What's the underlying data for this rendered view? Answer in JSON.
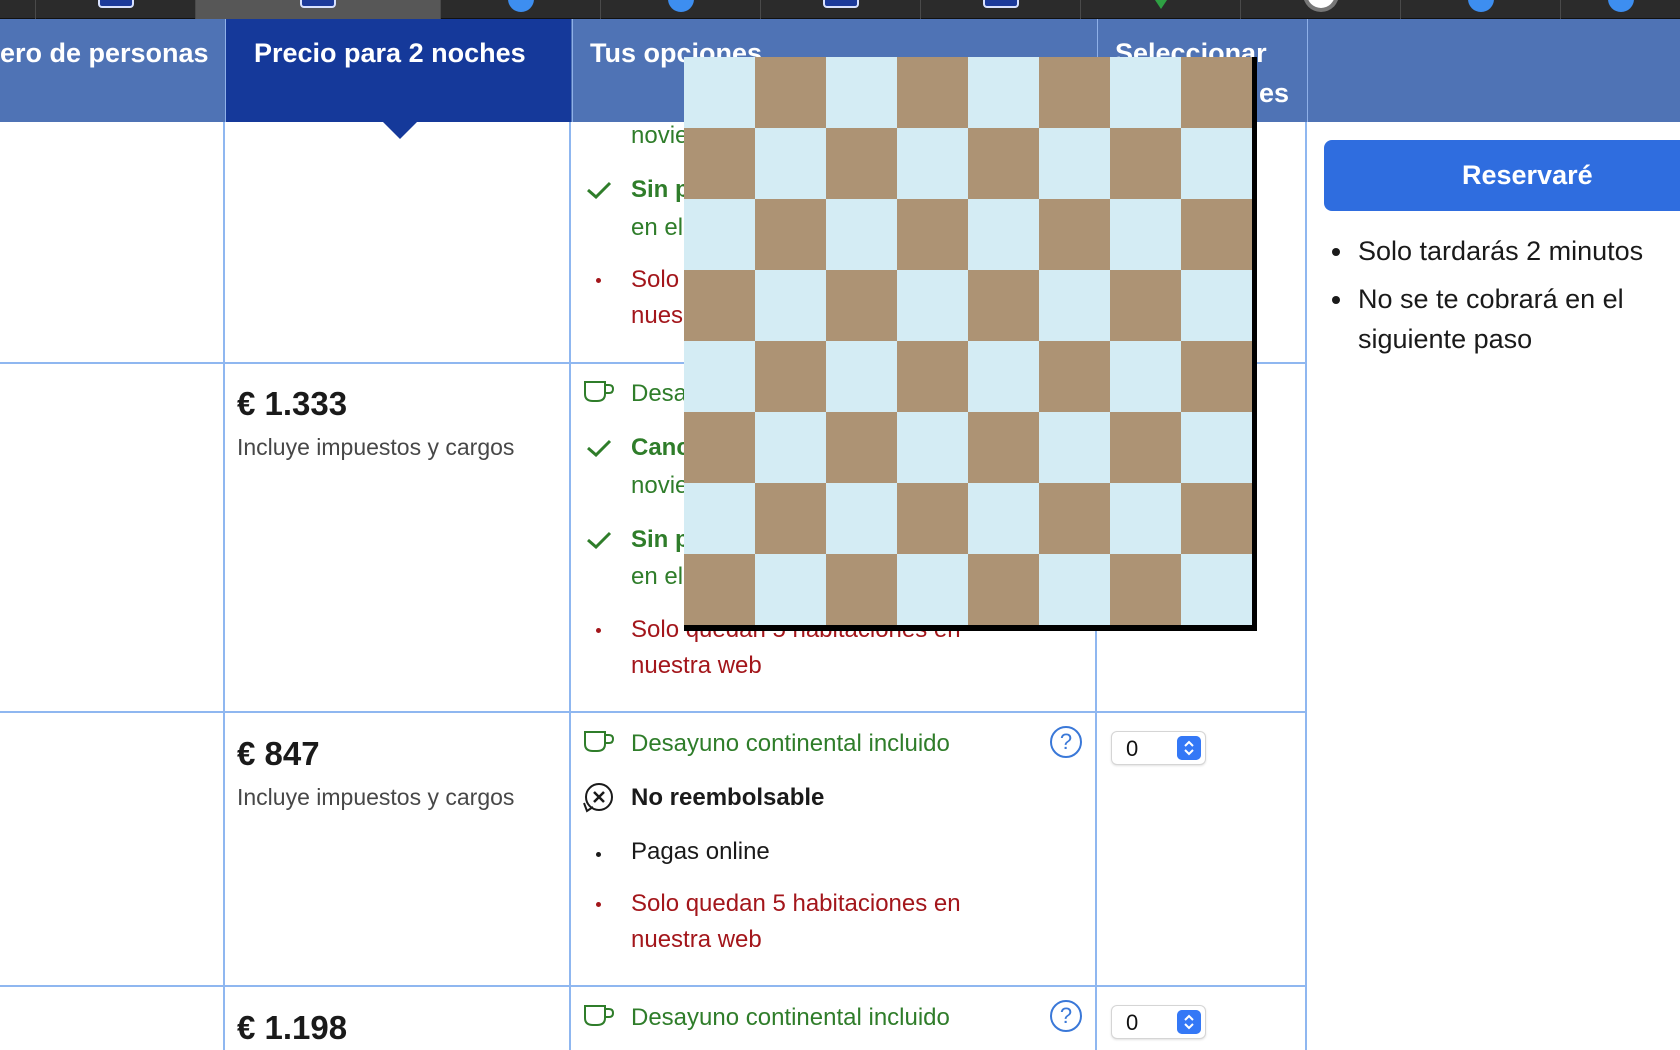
{
  "tabs": [
    {
      "icon": "square-favicon"
    },
    {
      "icon": "square-favicon",
      "active": true
    },
    {
      "icon": "circle-favicon"
    },
    {
      "icon": "circle-favicon"
    },
    {
      "icon": "square-favicon"
    },
    {
      "icon": "square-favicon"
    },
    {
      "icon": "triangle-favicon"
    },
    {
      "icon": "ring-favicon"
    },
    {
      "icon": "circle-favicon"
    },
    {
      "icon": "circle-favicon"
    }
  ],
  "header": {
    "col_persons": "ero de personas",
    "col_price": "Precio para 2 noches",
    "col_options": "Tus opciones",
    "col_select_line1": "Seleccionar",
    "col_select_line2": "es"
  },
  "rows": [
    {
      "options": {
        "line_top": "novie",
        "item1_bold": "Sin p",
        "item1_sub": "en el",
        "item2_line1": "Solo",
        "item2_line2": "nues"
      }
    },
    {
      "price": "€ 1.333",
      "price_note": "Incluye impuestos y cargos",
      "options": {
        "breakfast": "Desa",
        "cancel_bold": "Canc",
        "cancel_sub": "novie",
        "prepay_bold": "Sin p",
        "prepay_sub": "en el",
        "avail_line1": "Solo quedan 5 habitaciones en",
        "avail_line2": "nuestra web"
      }
    },
    {
      "price": "€ 847",
      "price_note": "Incluye impuestos y cargos",
      "options": {
        "breakfast": "Desayuno continental incluido",
        "refund": "No reembolsable",
        "pay": "Pagas online",
        "avail_line1": "Solo quedan 5 habitaciones en",
        "avail_line2": "nuestra web"
      },
      "qty": "0"
    },
    {
      "price": "€ 1.198",
      "options": {
        "breakfast": "Desayuno continental incluido"
      },
      "qty": "0"
    }
  ],
  "help_symbol": "?",
  "sidebar": {
    "reserve_label": "Reservaré",
    "bullets": [
      "Solo tardarás 2 minutos",
      "No se te cobrará en el",
      "siguiente paso"
    ]
  },
  "colors": {
    "header_bg": "#4f73b5",
    "selected_header": "#15399a",
    "green": "#2f7d2a",
    "red": "#a3161b",
    "board_brown": "#ad9374",
    "board_light": "#d4ecf4"
  }
}
